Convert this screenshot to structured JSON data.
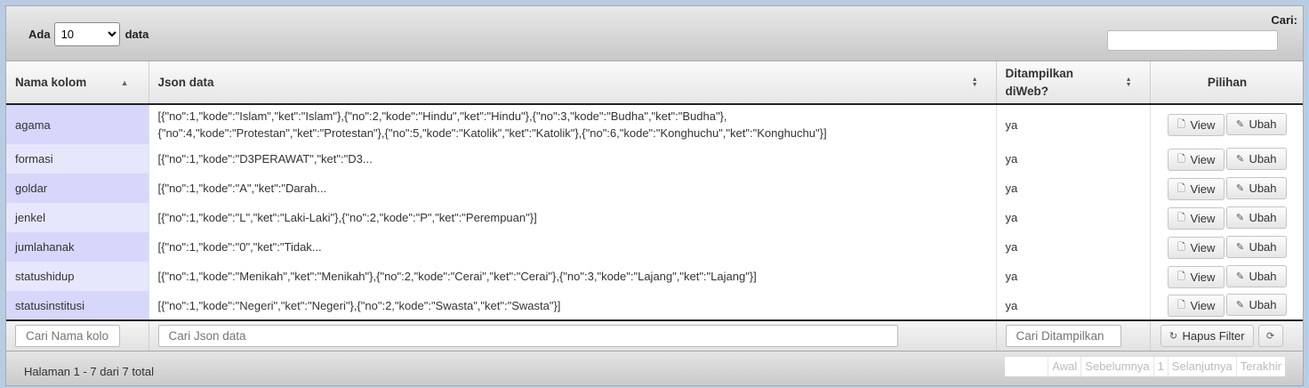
{
  "length_control": {
    "prefix": "Ada",
    "selected": "10",
    "suffix": "data"
  },
  "search": {
    "label": "Cari:",
    "value": ""
  },
  "columns": {
    "nama": "Nama kolom",
    "json": "Json data",
    "tampil_l1": "Ditampilkan",
    "tampil_l2": "diWeb?",
    "pilihan": "Pilihan"
  },
  "buttons": {
    "view": "View",
    "ubah": "Ubah"
  },
  "rows": [
    {
      "name": "agama",
      "json_l1": "[{\"no\":1,\"kode\":\"Islam\",\"ket\":\"Islam\"},{\"no\":2,\"kode\":\"Hindu\",\"ket\":\"Hindu\"},{\"no\":3,\"kode\":\"Budha\",\"ket\":\"Budha\"},",
      "json_l2": "{\"no\":4,\"kode\":\"Protestan\",\"ket\":\"Protestan\"},{\"no\":5,\"kode\":\"Katolik\",\"ket\":\"Katolik\"},{\"no\":6,\"kode\":\"Konghuchu\",\"ket\":\"Konghuchu\"}]",
      "shown": "ya"
    },
    {
      "name": "formasi",
      "json_l1": "[{\"no\":1,\"kode\":\"D3PERAWAT\",\"ket\":\"D3...",
      "json_l2": "",
      "shown": "ya"
    },
    {
      "name": "goldar",
      "json_l1": "[{\"no\":1,\"kode\":\"A\",\"ket\":\"Darah...",
      "json_l2": "",
      "shown": "ya"
    },
    {
      "name": "jenkel",
      "json_l1": "[{\"no\":1,\"kode\":\"L\",\"ket\":\"Laki-Laki\"},{\"no\":2,\"kode\":\"P\",\"ket\":\"Perempuan\"}]",
      "json_l2": "",
      "shown": "ya"
    },
    {
      "name": "jumlahanak",
      "json_l1": "[{\"no\":1,\"kode\":\"0\",\"ket\":\"Tidak...",
      "json_l2": "",
      "shown": "ya"
    },
    {
      "name": "statushidup",
      "json_l1": "[{\"no\":1,\"kode\":\"Menikah\",\"ket\":\"Menikah\"},{\"no\":2,\"kode\":\"Cerai\",\"ket\":\"Cerai\"},{\"no\":3,\"kode\":\"Lajang\",\"ket\":\"Lajang\"}]",
      "json_l2": "",
      "shown": "ya"
    },
    {
      "name": "statusinstitusi",
      "json_l1": "[{\"no\":1,\"kode\":\"Negeri\",\"ket\":\"Negeri\"},{\"no\":2,\"kode\":\"Swasta\",\"ket\":\"Swasta\"}]",
      "json_l2": "",
      "shown": "ya"
    }
  ],
  "filters": {
    "nama_placeholder": "Cari Nama kolom",
    "json_placeholder": "Cari Json data",
    "tampil_placeholder": "Cari Ditampilkan",
    "clear_label": "Hapus Filter"
  },
  "footer": {
    "info": "Halaman 1 - 7 dari 7 total",
    "pager": {
      "first": "Awal",
      "prev": "Sebelumnya",
      "page": "1",
      "next": "Selanjutnya",
      "last": "Terakhir"
    }
  }
}
